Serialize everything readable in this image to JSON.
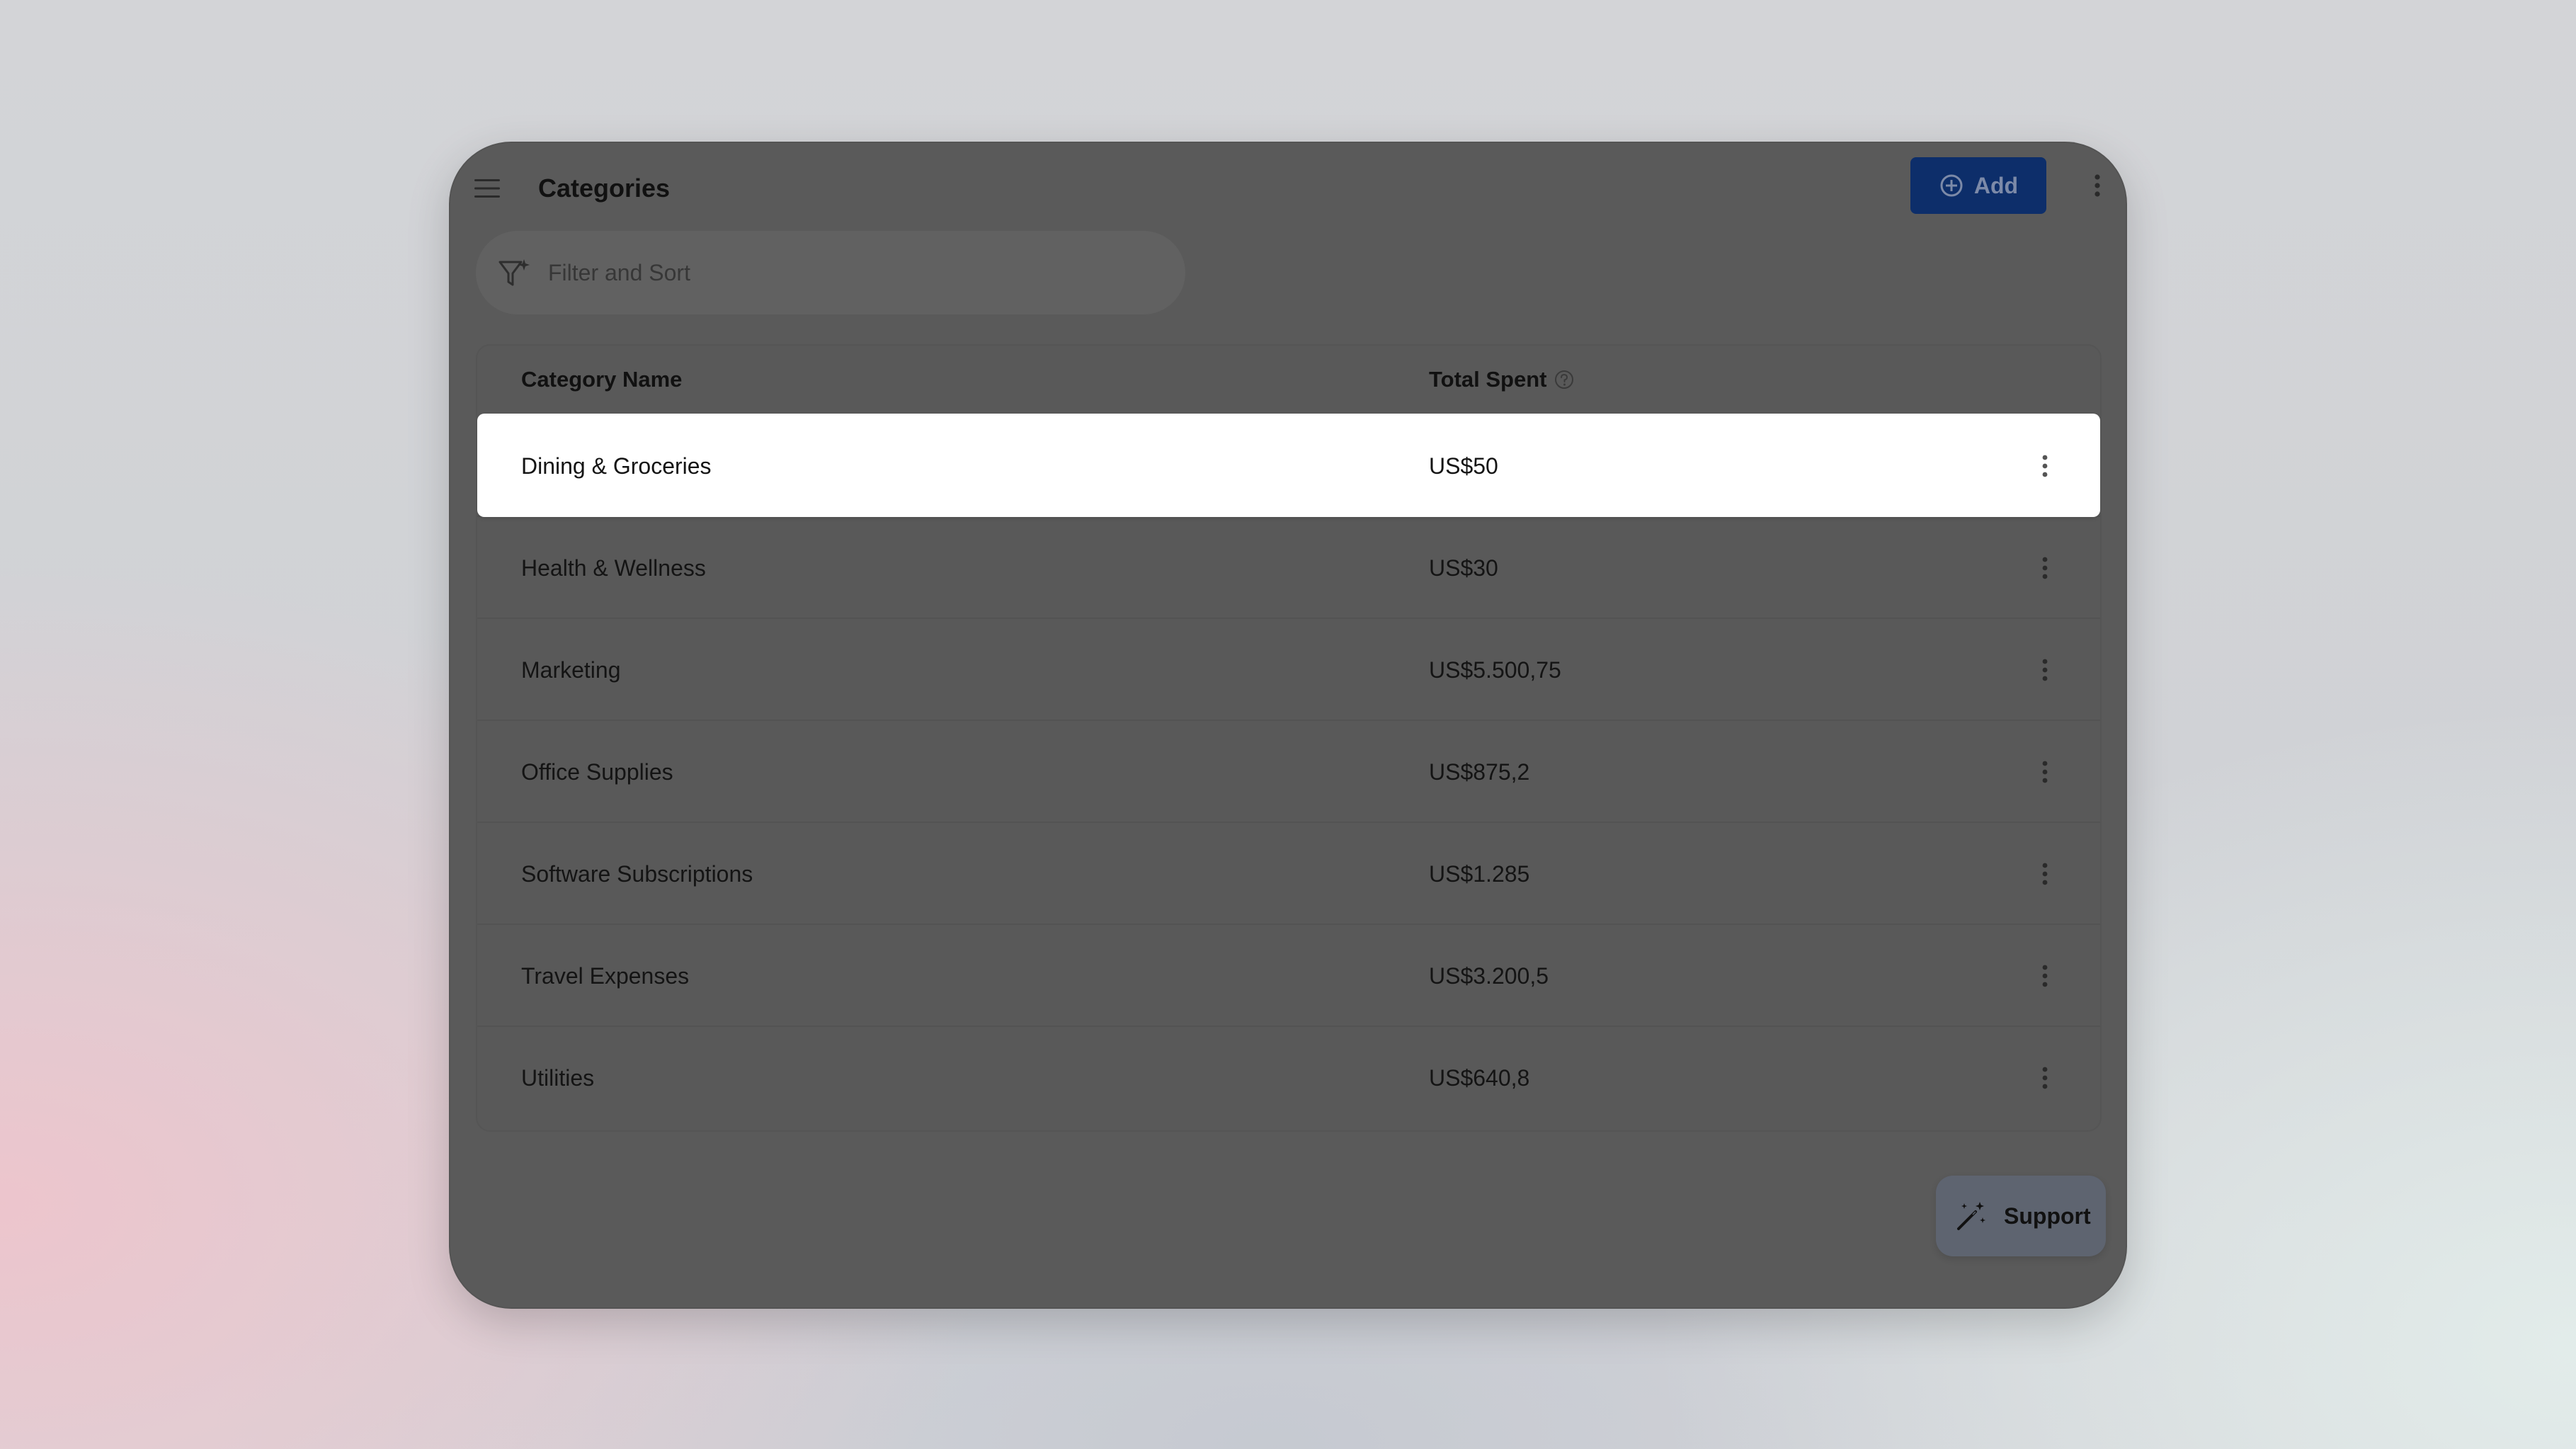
{
  "header": {
    "title": "Categories",
    "add_label": "Add"
  },
  "filter": {
    "placeholder": "Filter and Sort"
  },
  "table": {
    "columns": [
      "Category Name",
      "Total Spent"
    ],
    "rows": [
      {
        "name": "Dining & Groceries",
        "total": "US$50",
        "selected": true
      },
      {
        "name": "Health & Wellness",
        "total": "US$30",
        "selected": false
      },
      {
        "name": "Marketing",
        "total": "US$5.500,75",
        "selected": false
      },
      {
        "name": "Office Supplies",
        "total": "US$875,2",
        "selected": false
      },
      {
        "name": "Software Subscriptions",
        "total": "US$1.285",
        "selected": false
      },
      {
        "name": "Travel Expenses",
        "total": "US$3.200,5",
        "selected": false
      },
      {
        "name": "Utilities",
        "total": "US$640,8",
        "selected": false
      }
    ]
  },
  "support": {
    "label": "Support"
  },
  "icons": {
    "menu": "hamburger-menu-icon",
    "add": "plus-circle-icon",
    "overflow": "vertical-dots-icon",
    "filter": "filter-sparkle-icon",
    "help": "question-circle-icon",
    "row_menu": "vertical-dots-icon",
    "support": "magic-wand-icon"
  },
  "colors": {
    "accent": "#0d2e6a",
    "device_background": "#5a5a5a",
    "selected_row": "#ffffff"
  }
}
